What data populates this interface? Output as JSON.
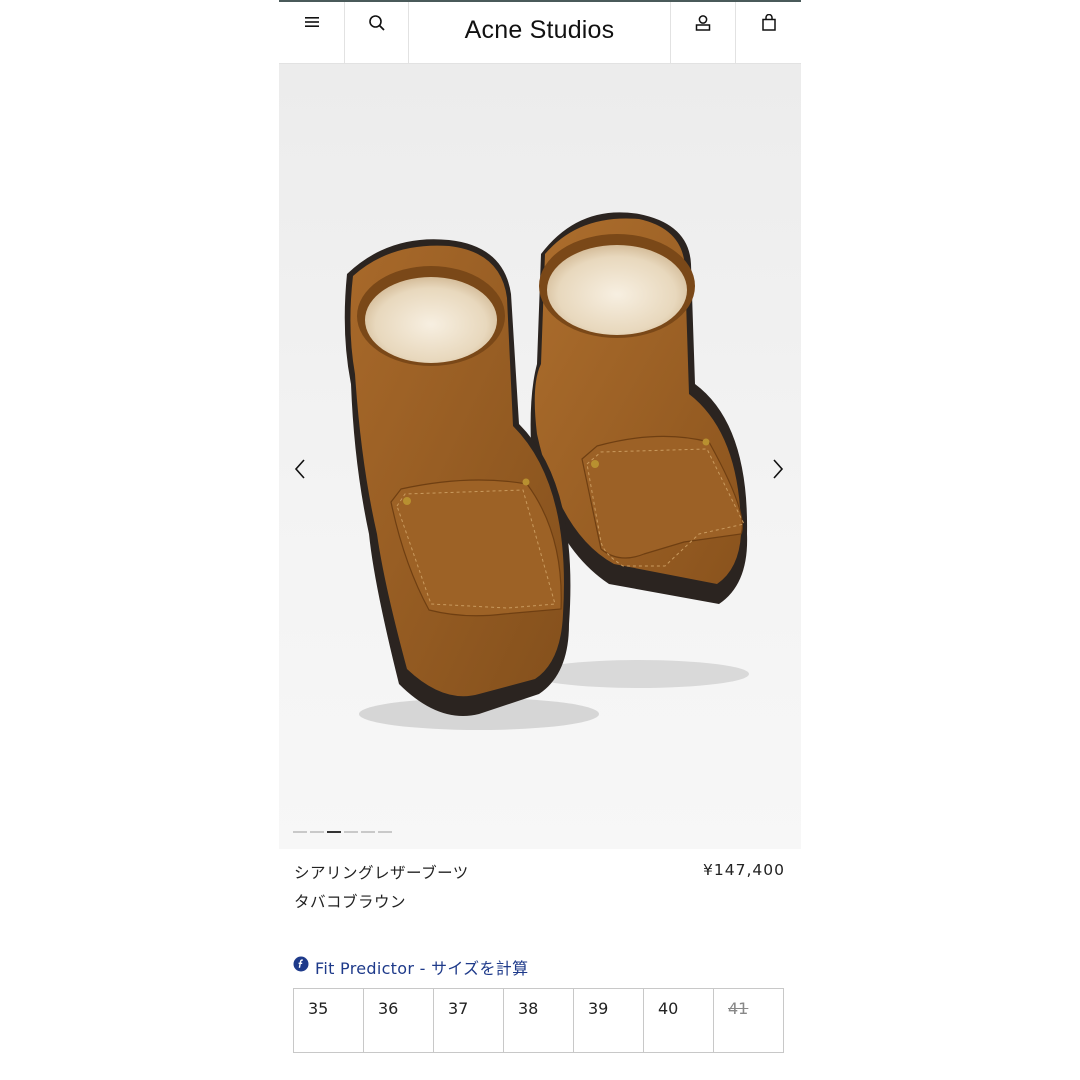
{
  "header": {
    "brand": "Acne Studios",
    "icons": [
      "menu-icon",
      "search-icon",
      "account-icon",
      "bag-icon"
    ]
  },
  "gallery": {
    "image_count": 6,
    "active_index": 2,
    "colors": {
      "suede": "#9a5f22",
      "fur": "#efe3cf",
      "sole": "#2b2420"
    }
  },
  "product": {
    "name": "シアリングレザーブーツ",
    "color": "タバコブラウン",
    "price": "¥147,400"
  },
  "fit_predictor": {
    "label": "Fit Predictor - サイズを計算",
    "color": "#1e3a8a"
  },
  "sizes": [
    {
      "label": "35",
      "available": true
    },
    {
      "label": "36",
      "available": true
    },
    {
      "label": "37",
      "available": true
    },
    {
      "label": "38",
      "available": true
    },
    {
      "label": "39",
      "available": true
    },
    {
      "label": "40",
      "available": true
    },
    {
      "label": "41",
      "available": false
    }
  ]
}
